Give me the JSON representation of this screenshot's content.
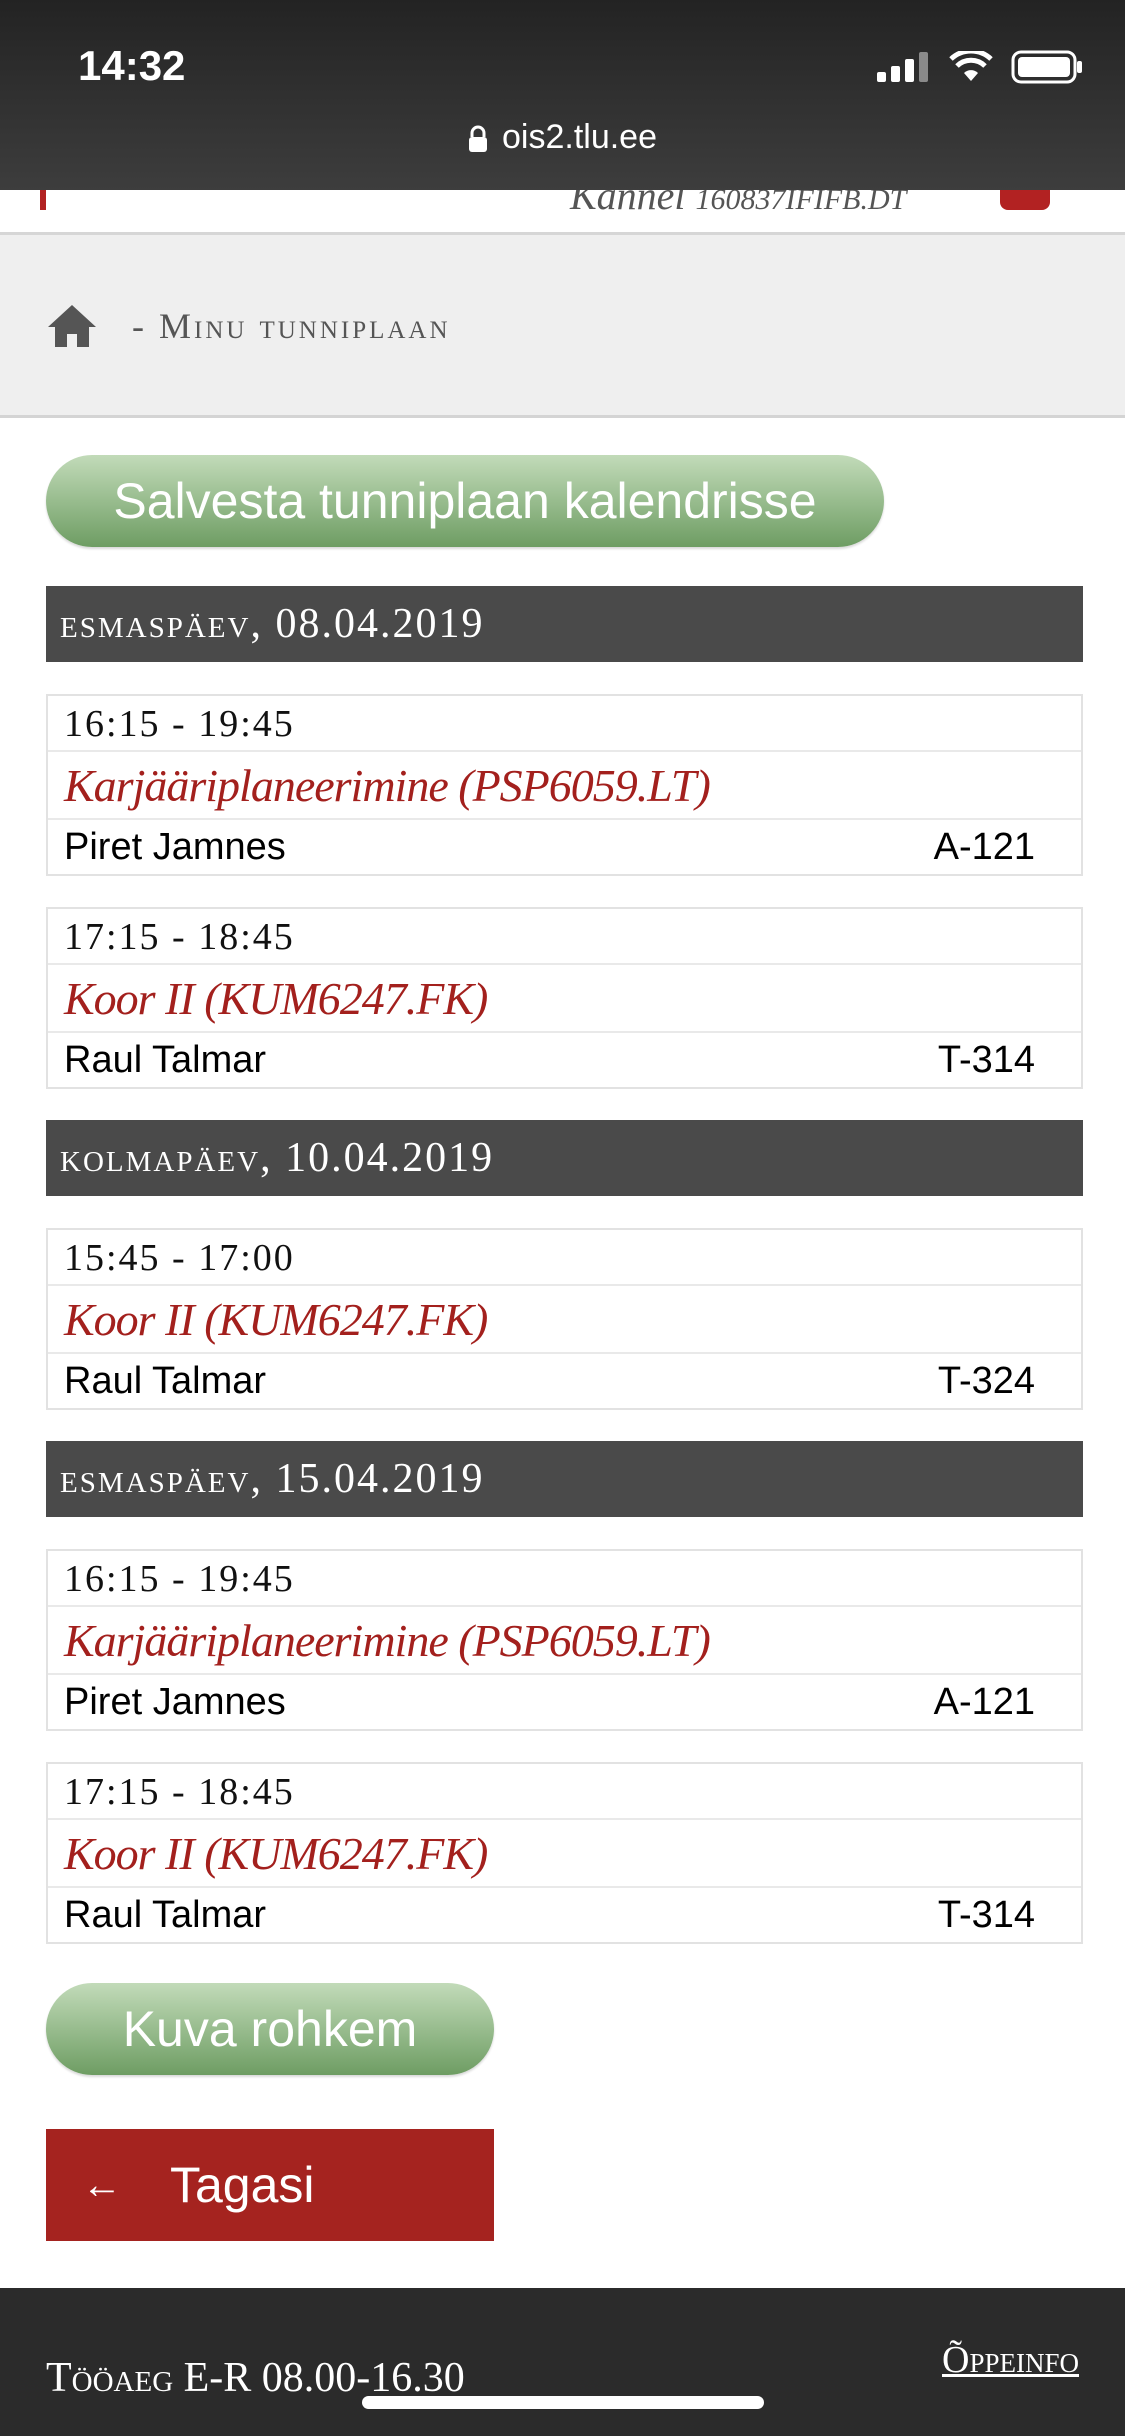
{
  "status_bar": {
    "time": "14:32",
    "url": "ois2.tlu.ee"
  },
  "header": {
    "user_name": "Kannel",
    "user_code": "160837IFIFB.DT"
  },
  "breadcrumb": {
    "separator": "-",
    "title": "Minu tunniplaan"
  },
  "save_button_label": "Salvesta tunniplaan kalendrisse",
  "days": [
    {
      "name": "esmaspäev",
      "date": ", 08.04.2019",
      "lessons": [
        {
          "time": "16:15 - 19:45",
          "course": "Karjääriplaneerimine (PSP6059.LT)",
          "teacher": "Piret Jamnes",
          "room": "A-121"
        },
        {
          "time": "17:15 - 18:45",
          "course": "Koor II (KUM6247.FK)",
          "teacher": "Raul Talmar",
          "room": "T-314"
        }
      ]
    },
    {
      "name": "kolmapäev",
      "date": ", 10.04.2019",
      "lessons": [
        {
          "time": "15:45 - 17:00",
          "course": "Koor II (KUM6247.FK)",
          "teacher": "Raul Talmar",
          "room": "T-324"
        }
      ]
    },
    {
      "name": "esmaspäev",
      "date": ", 15.04.2019",
      "lessons": [
        {
          "time": "16:15 - 19:45",
          "course": "Karjääriplaneerimine (PSP6059.LT)",
          "teacher": "Piret Jamnes",
          "room": "A-121"
        },
        {
          "time": "17:15 - 18:45",
          "course": "Koor II (KUM6247.FK)",
          "teacher": "Raul Talmar",
          "room": "T-314"
        }
      ]
    }
  ],
  "more_button_label": "Kuva rohkem",
  "back_button": {
    "arrow": "←",
    "label": "Tagasi"
  },
  "footer": {
    "hours_label": "Tööaeg",
    "hours_value": "E-R 08.00-16.30",
    "info_link": "Õppeinfo"
  },
  "colors": {
    "accent_red": "#a5231f",
    "green_button": "#7aa86e",
    "day_header": "#4a4a4a"
  }
}
